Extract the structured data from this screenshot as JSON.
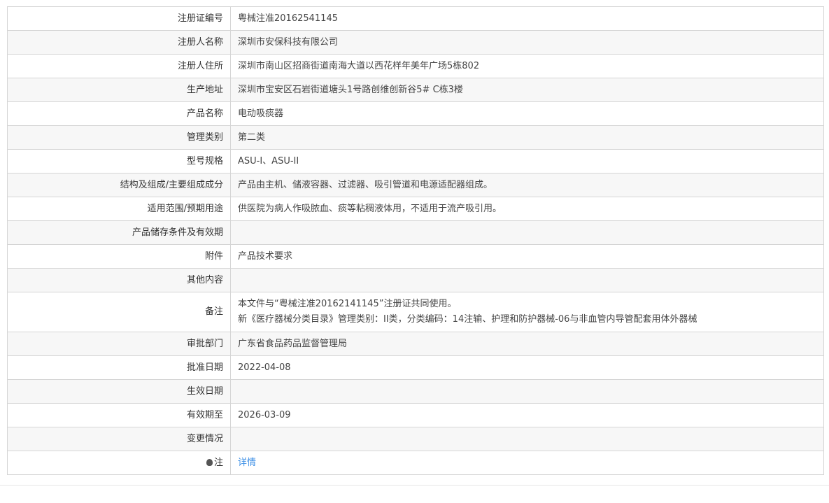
{
  "rows": [
    {
      "label": "注册证编号",
      "value": "粤械注准20162541145"
    },
    {
      "label": "注册人名称",
      "value": "深圳市安保科技有限公司"
    },
    {
      "label": "注册人住所",
      "value": "深圳市南山区招商街道南海大道以西花样年美年广场5栋802"
    },
    {
      "label": "生产地址",
      "value": "深圳市宝安区石岩街道塘头1号路创维创新谷5# C栋3楼"
    },
    {
      "label": "产品名称",
      "value": "电动吸痰器"
    },
    {
      "label": "管理类别",
      "value": "第二类"
    },
    {
      "label": "型号规格",
      "value": "ASU-I、ASU-II"
    },
    {
      "label": "结构及组成/主要组成成分",
      "value": "产品由主机、储液容器、过滤器、吸引管道和电源适配器组成。"
    },
    {
      "label": "适用范围/预期用途",
      "value": "供医院为病人作吸脓血、痰等粘稠液体用，不适用于流产吸引用。"
    },
    {
      "label": "产品储存条件及有效期",
      "value": ""
    },
    {
      "label": "附件",
      "value": "产品技术要求"
    },
    {
      "label": "其他内容",
      "value": ""
    }
  ],
  "remark": {
    "label": "备注",
    "line1": "本文件与“粤械注准20162141145”注册证共同使用。",
    "line2": "新《医疗器械分类目录》管理类别：II类，分类编码：14注输、护理和防护器械-06与非血管内导管配套用体外器械"
  },
  "rows2": [
    {
      "label": "审批部门",
      "value": "广东省食品药品监督管理局"
    },
    {
      "label": "批准日期",
      "value": "2022-04-08"
    },
    {
      "label": "生效日期",
      "value": ""
    },
    {
      "label": "有效期至",
      "value": "2026-03-09"
    },
    {
      "label": "变更情况",
      "value": ""
    }
  ],
  "note": {
    "label": "注",
    "link": "详情"
  }
}
